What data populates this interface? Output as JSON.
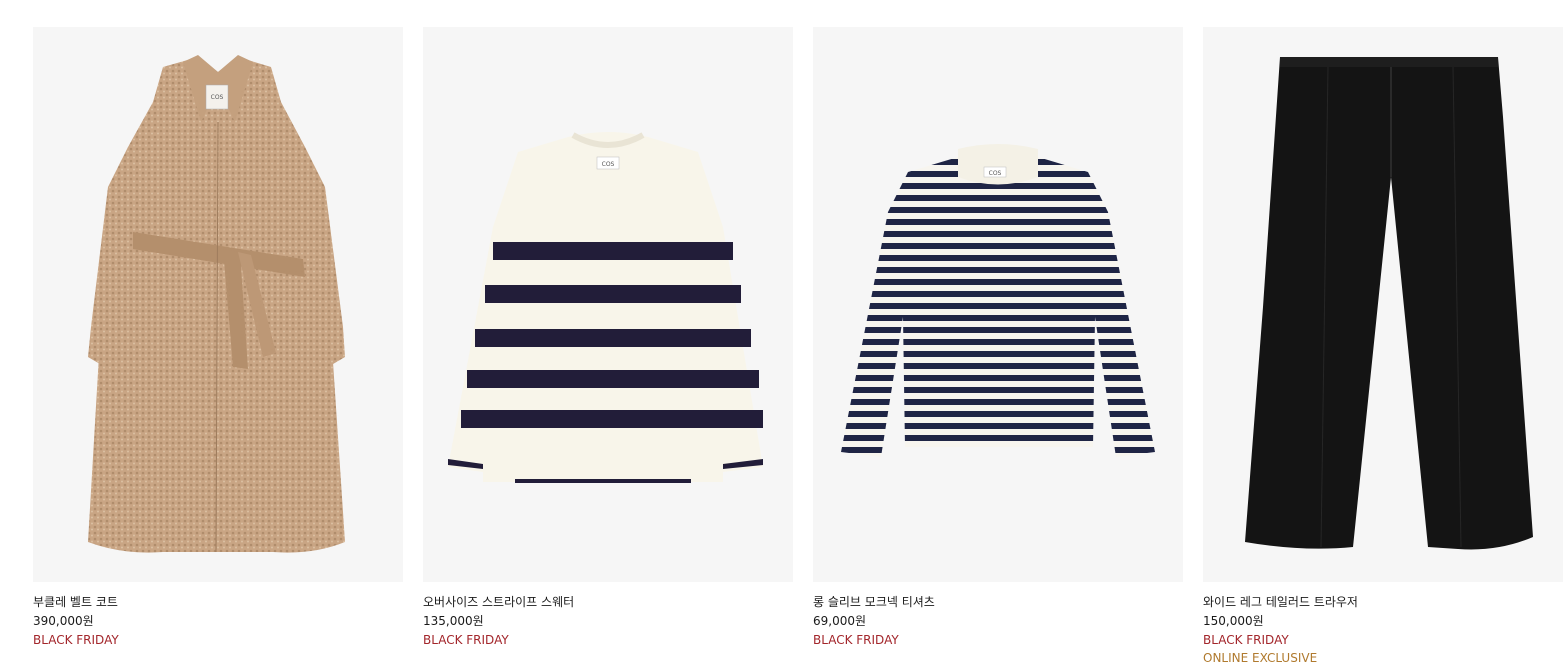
{
  "colors": {
    "black_friday": "#a3262b",
    "online_exclusive": "#b07a2e"
  },
  "products": [
    {
      "name": "부클레 벨트 코트",
      "price": "390,000원",
      "tags": [
        "BLACK FRIDAY"
      ],
      "image_icon": "boucle-belted-coat-image",
      "label_text": "COS"
    },
    {
      "name": "오버사이즈 스트라이프 스웨터",
      "price": "135,000원",
      "tags": [
        "BLACK FRIDAY"
      ],
      "image_icon": "striped-sweater-image",
      "label_text": "COS"
    },
    {
      "name": "롱 슬리브 모크넥 티셔츠",
      "price": "69,000원",
      "tags": [
        "BLACK FRIDAY"
      ],
      "image_icon": "striped-mockneck-tshirt-image",
      "label_text": "COS"
    },
    {
      "name": "와이드 레그 테일러드 트라우저",
      "price": "150,000원",
      "tags": [
        "BLACK FRIDAY",
        "ONLINE EXCLUSIVE"
      ],
      "image_icon": "wide-leg-trousers-image"
    }
  ]
}
